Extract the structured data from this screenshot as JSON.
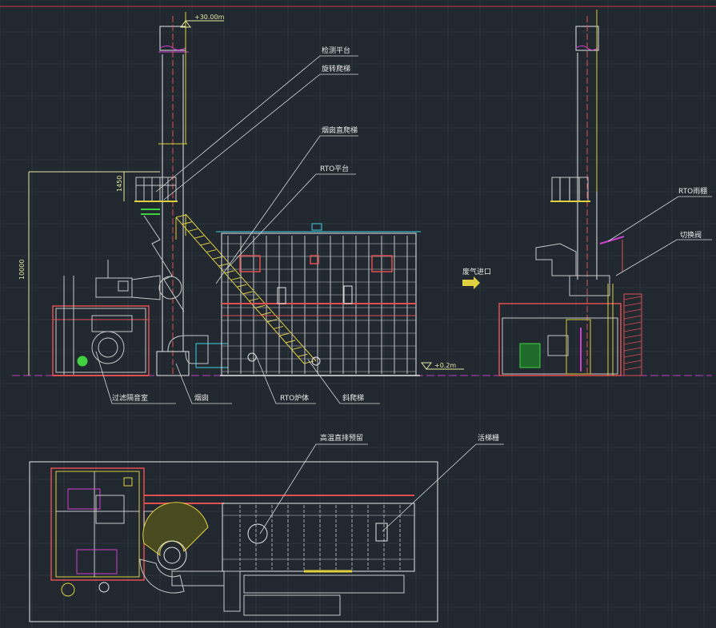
{
  "elevations": {
    "top": "+30.00m",
    "ground": "+0.2m"
  },
  "dimensions": {
    "total_height": "10000",
    "platform_height": "1450"
  },
  "labels": {
    "inspection_platform": "检测平台",
    "spiral_ladder": "旋转爬梯",
    "chimney_straight_ladder": "烟囱直爬梯",
    "rto_platform": "RTO平台",
    "waste_gas_inlet": "废气进口",
    "rto_rain_shed": "RTO雨棚",
    "switching_valve": "切换阀",
    "filter_sound_room": "过滤隔音室",
    "chimney": "烟囱",
    "rto_furnace": "RTO炉体",
    "inclined_ladder": "斜爬梯",
    "high_temp_bypass": "高温直排预留",
    "handrail": "活梯栅"
  },
  "colors": {
    "background": "#212830",
    "outline": "#e6e6e6",
    "frame": "#c8c8c8",
    "ladder": "#e0d040",
    "structure": "#e05050",
    "accent": "#d040d0",
    "leader": "#d8d8d8",
    "ground_line": "#c040c0",
    "cyan": "#40d0e0",
    "green": "#40d040"
  }
}
